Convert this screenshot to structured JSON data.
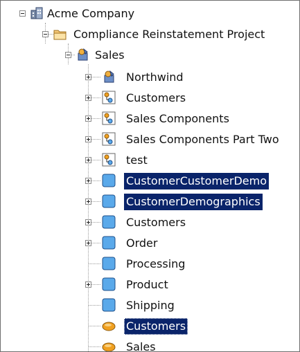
{
  "tree": {
    "root": {
      "label": "Acme Company",
      "icon": "company-icon",
      "expanded": true
    },
    "project": {
      "label": "Compliance Reinstatement  Project",
      "icon": "folder-icon",
      "expanded": true
    },
    "sales": {
      "label": "Sales",
      "icon": "package-icon",
      "expanded": true
    },
    "children": [
      {
        "label": "Northwind",
        "icon": "package-icon",
        "expander": "plus",
        "selected": false
      },
      {
        "label": "Customers",
        "icon": "model-icon",
        "expander": "plus",
        "selected": false
      },
      {
        "label": "Sales Components",
        "icon": "model-icon",
        "expander": "plus",
        "selected": false
      },
      {
        "label": "Sales Components Part Two",
        "icon": "model-icon",
        "expander": "plus",
        "selected": false
      },
      {
        "label": "test",
        "icon": "model-icon",
        "expander": "plus",
        "selected": false
      },
      {
        "label": "CustomerCustomerDemo",
        "icon": "entity-icon",
        "expander": "plus",
        "selected": true
      },
      {
        "label": "CustomerDemographics",
        "icon": "entity-icon",
        "expander": "plus",
        "selected": true
      },
      {
        "label": "Customers",
        "icon": "entity-icon",
        "expander": "plus",
        "selected": false
      },
      {
        "label": "Order",
        "icon": "entity-icon",
        "expander": "plus",
        "selected": false
      },
      {
        "label": "Processing",
        "icon": "entity-icon",
        "expander": "none",
        "selected": false
      },
      {
        "label": "Product",
        "icon": "entity-icon",
        "expander": "plus",
        "selected": false
      },
      {
        "label": "Shipping",
        "icon": "entity-icon",
        "expander": "none",
        "selected": false
      },
      {
        "label": "Customers",
        "icon": "process-icon",
        "expander": "none",
        "selected": true
      },
      {
        "label": "Sales",
        "icon": "process-icon",
        "expander": "none",
        "selected": false
      }
    ]
  },
  "colors": {
    "selection": "#0a246a",
    "entity_fill": "#5aa9ea",
    "process_fill": "#f0a020",
    "folder_fill": "#f4c878"
  }
}
